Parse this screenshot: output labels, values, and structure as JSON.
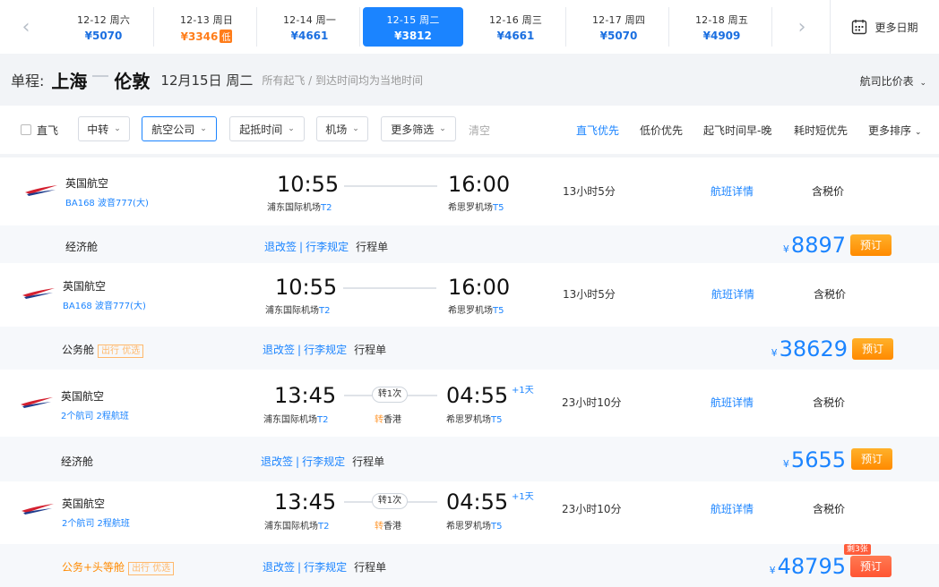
{
  "dates": [
    {
      "date": "12-12",
      "weekday": "周六",
      "price": "¥5070"
    },
    {
      "date": "12-13",
      "weekday": "周日",
      "price": "¥3346",
      "low": "低"
    },
    {
      "date": "12-14",
      "weekday": "周一",
      "price": "¥4661"
    },
    {
      "date": "12-15",
      "weekday": "周二",
      "price": "¥3812"
    },
    {
      "date": "12-16",
      "weekday": "周三",
      "price": "¥4661"
    },
    {
      "date": "12-17",
      "weekday": "周四",
      "price": "¥5070"
    },
    {
      "date": "12-18",
      "weekday": "周五",
      "price": "¥4909"
    }
  ],
  "more_dates": "更多日期",
  "route": {
    "type": "单程:",
    "from": "上海",
    "to": "伦敦",
    "date": "12月15日 周二",
    "note": "所有起飞 / 到达时间均为当地时间"
  },
  "compare": "航司比价表",
  "filters": {
    "direct": "直飞",
    "transfer": "中转",
    "airline": "航空公司",
    "time": "起抵时间",
    "airport": "机场",
    "more": "更多筛选",
    "clear": "清空"
  },
  "sorts": [
    "直飞优先",
    "低价优先",
    "起飞时间早-晚",
    "耗时短优先",
    "更多排序"
  ],
  "flights": [
    {
      "airline": "英国航空",
      "flight": "BA168 波音777(大)",
      "dep_time": "10:55",
      "dep_airport": "浦东国际机场",
      "dep_terminal": "T2",
      "arr_time": "16:00",
      "arr_airport": "希思罗机场",
      "arr_terminal": "T5",
      "duration": "13小时5分",
      "detail": "航班详情",
      "tax": "含税价",
      "cabin": "经济舱",
      "rule1": "退改签",
      "rule2": "行李规定",
      "itin": "行程单",
      "price": "8897",
      "book": "预订"
    },
    {
      "airline": "英国航空",
      "flight": "BA168 波音777(大)",
      "dep_time": "10:55",
      "dep_airport": "浦东国际机场",
      "dep_terminal": "T2",
      "arr_time": "16:00",
      "arr_airport": "希思罗机场",
      "arr_terminal": "T5",
      "duration": "13小时5分",
      "detail": "航班详情",
      "tax": "含税价",
      "cabin": "公务舱",
      "cabin_tag": "出行 优选",
      "rule1": "退改签",
      "rule2": "行李规定",
      "itin": "行程单",
      "price": "38629",
      "book": "预订"
    },
    {
      "airline": "英国航空",
      "flight": "2个航司 2程航班",
      "dep_time": "13:45",
      "dep_airport": "浦东国际机场",
      "dep_terminal": "T2",
      "transfer": "转1次",
      "transfer_prefix": "转",
      "transfer_city": "香港",
      "arr_time": "04:55",
      "plus_day": "+1天",
      "arr_airport": "希思罗机场",
      "arr_terminal": "T5",
      "duration": "23小时10分",
      "detail": "航班详情",
      "tax": "含税价",
      "cabin": "经济舱",
      "rule1": "退改签",
      "rule2": "行李规定",
      "itin": "行程单",
      "price": "5655",
      "book": "预订"
    },
    {
      "airline": "英国航空",
      "flight": "2个航司 2程航班",
      "dep_time": "13:45",
      "dep_airport": "浦东国际机场",
      "dep_terminal": "T2",
      "transfer": "转1次",
      "transfer_prefix": "转",
      "transfer_city": "香港",
      "arr_time": "04:55",
      "plus_day": "+1天",
      "arr_airport": "希思罗机场",
      "arr_terminal": "T5",
      "duration": "23小时10分",
      "detail": "航班详情",
      "tax": "含税价",
      "cabin": "公务+头等舱",
      "cabin_tag": "出行 优选",
      "rule1": "退改签",
      "rule2": "行李规定",
      "itin": "行程单",
      "price": "48795",
      "book": "预订",
      "remain": "剩3张"
    }
  ],
  "currency": "¥",
  "colors": {
    "primary": "#1b84ff",
    "orange": "#ff8a00",
    "low": "#ff7d1a"
  }
}
